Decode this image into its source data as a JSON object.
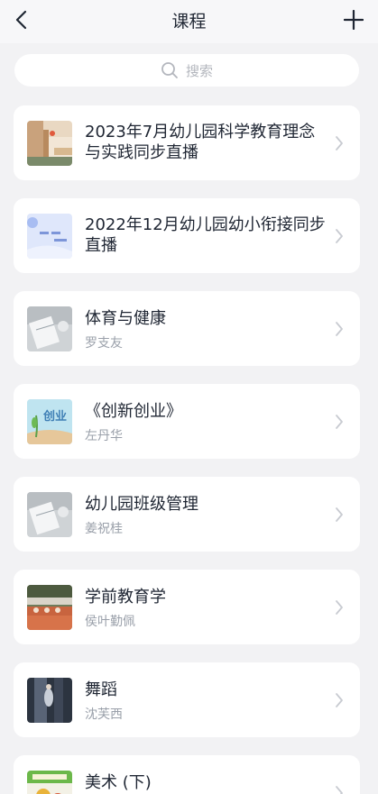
{
  "header": {
    "title": "课程"
  },
  "search": {
    "placeholder": "搜索"
  },
  "courses": [
    {
      "title": "2023年7月幼儿园科学教育理念与实践同步直播",
      "teacher": ""
    },
    {
      "title": "2022年12月幼儿园幼小衔接同步直播",
      "teacher": ""
    },
    {
      "title": "体育与健康",
      "teacher": "罗支友"
    },
    {
      "title": "《创新创业》",
      "teacher": "左丹华"
    },
    {
      "title": "幼儿园班级管理",
      "teacher": "姜祝桂"
    },
    {
      "title": "学前教育学",
      "teacher": "侯叶勤佩"
    },
    {
      "title": "舞蹈",
      "teacher": "沈芙西"
    },
    {
      "title": "美术 (下)",
      "teacher": ""
    }
  ],
  "thumb_text": {
    "chuangye": "创业"
  }
}
